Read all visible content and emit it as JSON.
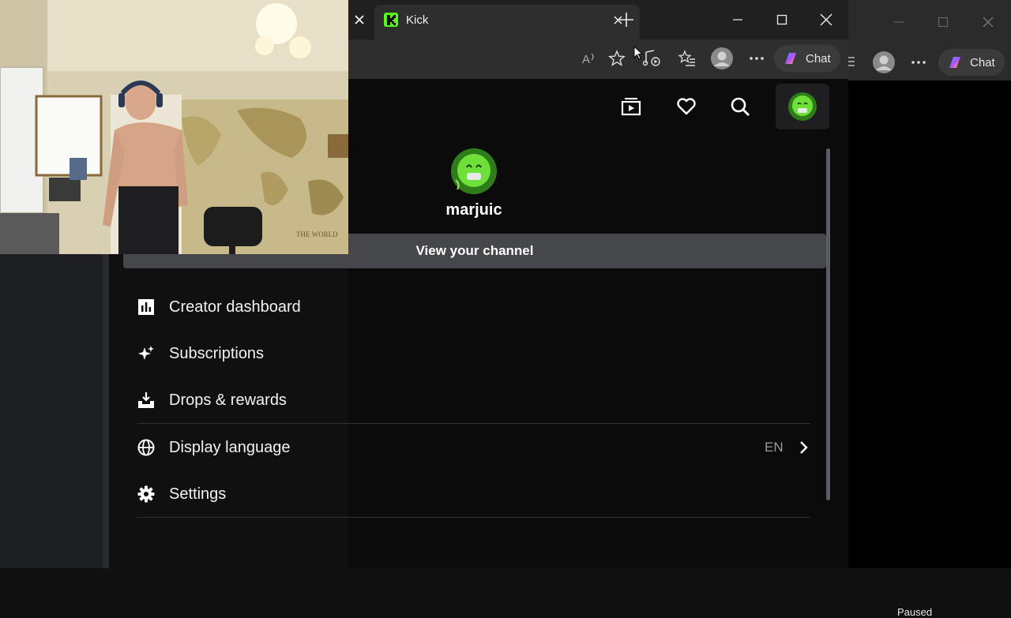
{
  "browser": {
    "tab": {
      "title": "Kick"
    },
    "toolbar": {
      "chat_label": "Chat"
    }
  },
  "background_window": {
    "chat_label": "Chat",
    "status": "Paused"
  },
  "user_menu": {
    "username": "marjuic",
    "view_channel_label": "View your channel",
    "items": [
      {
        "label": "Creator dashboard",
        "icon": "chart-bars-icon"
      },
      {
        "label": "Subscriptions",
        "icon": "sparkle-icon"
      },
      {
        "label": "Drops & rewards",
        "icon": "drop-tray-icon"
      },
      {
        "label": "Display language",
        "icon": "globe-icon",
        "value": "EN"
      },
      {
        "label": "Settings",
        "icon": "gear-icon"
      }
    ]
  },
  "webcam": {
    "poster_text": "THE WORLD"
  },
  "colors": {
    "kick_green": "#53fc18",
    "page_bg": "#0b0b0c",
    "button_bg": "#45474b"
  }
}
